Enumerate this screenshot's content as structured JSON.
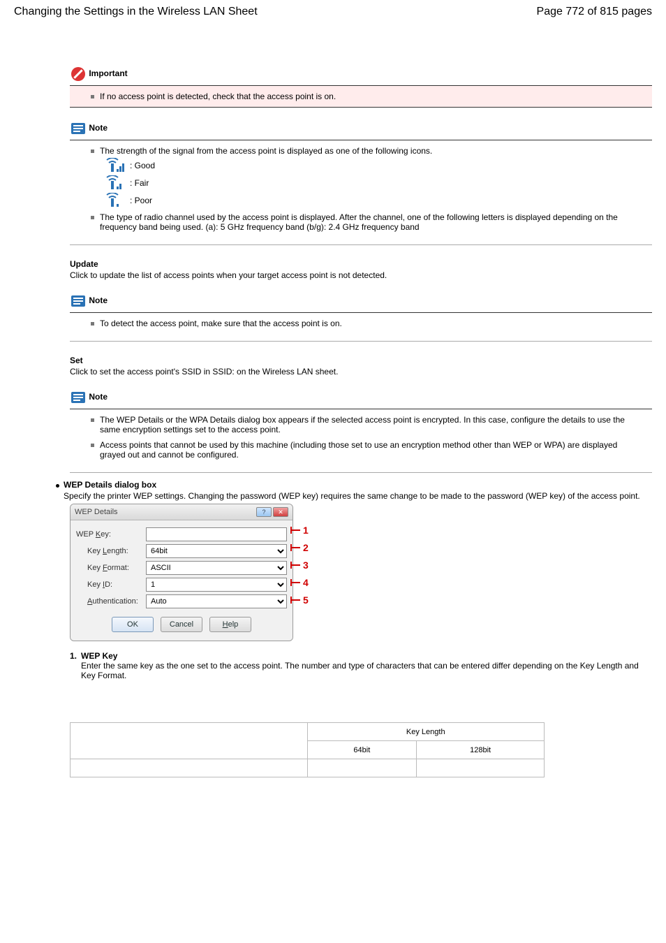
{
  "header": {
    "title_left": "Changing the Settings in the Wireless LAN Sheet",
    "title_right": "Page 772 of 815 pages"
  },
  "important": {
    "label": "Important",
    "text": "If no access point is detected, check that the access point is on."
  },
  "note1": {
    "label": "Note",
    "strength_intro": "The strength of the signal from the access point is displayed as one of the following icons.",
    "s_good": ": Good",
    "s_fair": ": Fair",
    "s_poor": ": Poor",
    "channel_text": "The type of radio channel used by the access point is displayed. After the channel, one of the following letters is displayed depending on the frequency band being used. (a): 5 GHz frequency band (b/g): 2.4 GHz frequency band"
  },
  "update": {
    "label": "Update",
    "desc": "Click to update the list of access points when your target access point is not detected."
  },
  "note2": {
    "label": "Note",
    "text": "To detect the access point, make sure that the access point is on."
  },
  "set": {
    "label": "Set",
    "desc": "Click to set the access point's SSID in SSID: on the Wireless LAN sheet."
  },
  "note3": {
    "label": "Note",
    "line1": "The WEP Details or the WPA Details dialog box appears if the selected access point is encrypted. In this case, configure the details to use the same encryption settings set to the access point.",
    "line2": "Access points that cannot be used by this machine (including those set to use an encryption method other than WEP or WPA) are displayed grayed out and cannot be configured."
  },
  "wep": {
    "heading": "WEP Details dialog box",
    "intro1": "Specify the printer WEP settings. Changing the password (WEP key) requires the same change to be made to the password (WEP key) of the access point.",
    "dlg_title": "WEP Details",
    "rows": {
      "wepkey_label_pre": "WEP ",
      "wepkey_label_ul": "K",
      "wepkey_label_post": "ey:",
      "wepkey_value": "",
      "length_label_pre": "Key ",
      "length_label_ul": "L",
      "length_label_post": "ength:",
      "length_value": "64bit",
      "format_label_pre": "Key ",
      "format_label_ul": "F",
      "format_label_post": "ormat:",
      "format_value": "ASCII",
      "id_label_pre": "Key ",
      "id_label_ul": "I",
      "id_label_post": "D:",
      "id_value": "1",
      "auth_label_pre": "",
      "auth_label_ul": "A",
      "auth_label_post": "uthentication:",
      "auth_value": "Auto"
    },
    "buttons": {
      "ok": "OK",
      "cancel": "Cancel",
      "help_pre": "",
      "help_ul": "H",
      "help_post": "elp"
    },
    "callouts": {
      "c1": "1",
      "c2": "2",
      "c3": "3",
      "c4": "4",
      "c5": "5"
    }
  },
  "items": {
    "i1": {
      "num": "1.",
      "label": "WEP Key",
      "desc": "Enter the same key as the one set to the access point. The number and type of characters that can be entered differ depending on the Key Length and Key Format."
    },
    "table": {
      "col_kl": "Key Length",
      "col_64": "64bit",
      "col_128": "128bit"
    }
  }
}
